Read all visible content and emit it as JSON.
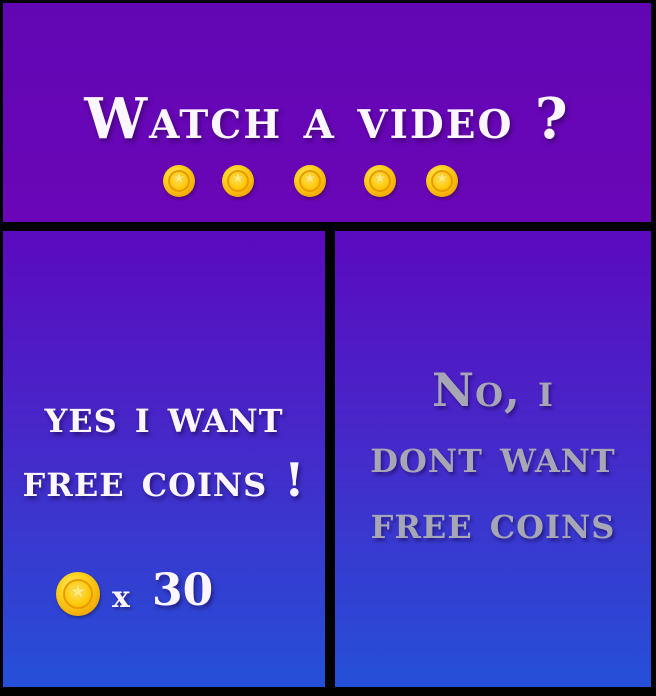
{
  "dialog": {
    "title": "Watch a video ?",
    "coin_row": [
      "coin-icon",
      "coin-icon",
      "coin-icon",
      "coin-icon",
      "coin-icon"
    ],
    "header_color": "#6206b4"
  },
  "yes_option": {
    "line1": "yes i want",
    "line2": "free coins !",
    "reward": {
      "icon": "coin-icon",
      "multiplier": "x",
      "amount": "30"
    },
    "text_color": "#fbf6ff"
  },
  "no_option": {
    "line1": "No, i",
    "line2": "dont want",
    "line3": "free coins",
    "text_color": "#a6a6b4"
  },
  "colors": {
    "panel_top": "#5b0abd",
    "panel_bottom": "#2550d8",
    "border": "#000000",
    "coin": "#ffc400"
  }
}
